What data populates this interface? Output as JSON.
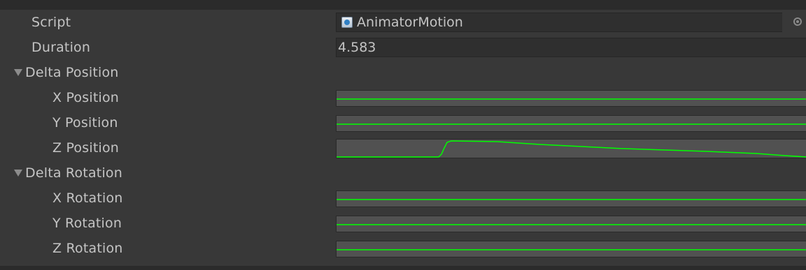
{
  "inspector": {
    "script": {
      "label": "Script",
      "value": "AnimatorMotion",
      "icon": "script-asset-icon",
      "picker_icon": "object-picker-icon"
    },
    "duration": {
      "label": "Duration",
      "value": "4.583"
    },
    "delta_position": {
      "label": "Delta Position",
      "expanded": true,
      "fields": [
        {
          "label": "X Position",
          "curve": "flat"
        },
        {
          "label": "Y Position",
          "curve": "flat"
        },
        {
          "label": "Z Position",
          "curve": "rise-then-decay"
        }
      ]
    },
    "delta_rotation": {
      "label": "Delta Rotation",
      "expanded": true,
      "fields": [
        {
          "label": "X Rotation",
          "curve": "flat"
        },
        {
          "label": "Y Rotation",
          "curve": "flat"
        },
        {
          "label": "Z Rotation",
          "curve": "flat"
        }
      ]
    },
    "colors": {
      "curve_line": "#00ff00",
      "curve_background": "#515151",
      "panel_background": "#383838",
      "text": "#c4c4c4"
    }
  }
}
